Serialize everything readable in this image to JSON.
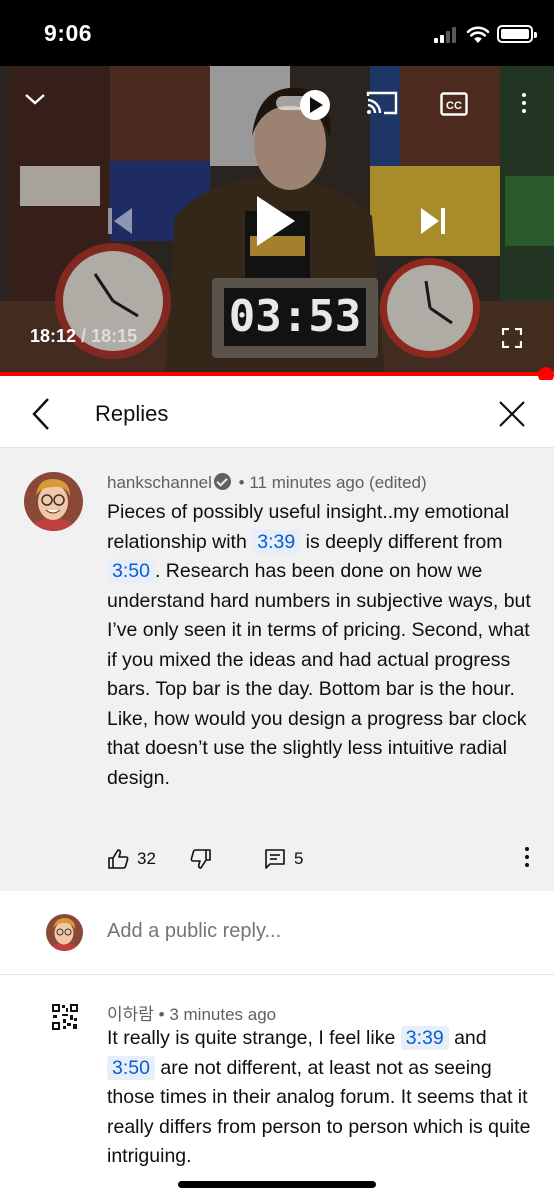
{
  "status_bar": {
    "time": "9:06"
  },
  "video": {
    "current_time": "18:12",
    "duration": "18:15",
    "time_separator": " / ",
    "flip_clock_display": "03:53",
    "progress": 0.997,
    "accent_color": "#ff0000"
  },
  "replies_header": {
    "title": "Replies"
  },
  "main_comment": {
    "author": "hankschannel",
    "time_ago": "• 11 minutes ago (edited)",
    "text_part1": "Pieces of possibly useful insight..my emotional relationship with ",
    "timestamp1": "3:39",
    "text_part2": " is deeply different from ",
    "timestamp2": "3:50",
    "text_part3": ". Research has been done on how we understand hard numbers in subjective ways, but I’ve only seen it in terms of pricing. Second, what if you mixed the ideas and had actual progress bars. Top bar is the day. Bottom bar is the hour. Like, how would you design a progress bar clock that doesn’t use the slightly less intuitive radial design.",
    "likes": "32",
    "replies_count": "5"
  },
  "add_reply": {
    "placeholder": "Add a public reply..."
  },
  "reply": {
    "author": "이하람",
    "time_ago": "• 3 minutes ago",
    "text_part1": "It really is quite strange, I feel like ",
    "timestamp1": "3:39",
    "text_part2": " and ",
    "timestamp2": "3:50",
    "text_part3": " are not different, at least not as seeing those times in their analog forum. It seems that it really differs from person to person which is quite intriguing."
  },
  "icons": {
    "chevron_down": "chevron-down-icon",
    "autoplay": "autoplay-toggle-icon",
    "cast": "cast-icon",
    "captions": "cc-icon",
    "more": "more-vert-icon",
    "previous": "skip-previous-icon",
    "play": "play-icon",
    "next": "skip-next-icon",
    "fullscreen": "fullscreen-icon",
    "back": "back-arrow-icon",
    "close": "close-icon",
    "like": "thumb-up-icon",
    "dislike": "thumb-down-icon",
    "comment": "comment-icon"
  }
}
